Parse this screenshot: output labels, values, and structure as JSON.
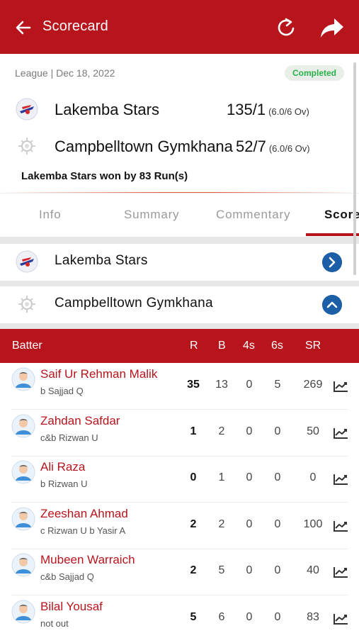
{
  "app_bar": {
    "title": "Scorecard",
    "back_icon": "arrow-left-icon",
    "refresh_icon": "refresh-icon",
    "share_icon": "share-icon"
  },
  "match": {
    "meta": "League | Dec 18, 2022",
    "status": "Completed",
    "teams": [
      {
        "name": "Lakemba Stars",
        "score": "135/1",
        "overs": "(6.0/6 Ov)"
      },
      {
        "name": "Campbelltown Gymkhana",
        "score": "52/7",
        "overs": "(6.0/6 Ov)"
      }
    ],
    "result": "Lakemba Stars won by 83 Run(s)"
  },
  "tabs": [
    {
      "label": "Info"
    },
    {
      "label": "Summary"
    },
    {
      "label": "Commentary"
    },
    {
      "label": "Score",
      "active": true
    }
  ],
  "innings": [
    {
      "team": "Lakemba Stars",
      "expanded": false
    },
    {
      "team": "Campbelltown Gymkhana",
      "expanded": true
    }
  ],
  "batting_table": {
    "headers": {
      "batter": "Batter",
      "r": "R",
      "b": "B",
      "fours": "4s",
      "sixes": "6s",
      "sr": "SR"
    },
    "rows": [
      {
        "name": "Saif Ur Rehman Malik",
        "dismissal": "b Sajjad Q",
        "r": "35",
        "b": "13",
        "fours": "0",
        "sixes": "5",
        "sr": "269"
      },
      {
        "name": "Zahdan Safdar",
        "dismissal": "c&b Rizwan U",
        "r": "1",
        "b": "2",
        "fours": "0",
        "sixes": "0",
        "sr": "50"
      },
      {
        "name": "Ali Raza",
        "dismissal": "b Rizwan U",
        "r": "0",
        "b": "1",
        "fours": "0",
        "sixes": "0",
        "sr": "0"
      },
      {
        "name": "Zeeshan Ahmad",
        "dismissal": "c Rizwan U b Yasir A",
        "r": "2",
        "b": "2",
        "fours": "0",
        "sixes": "0",
        "sr": "100"
      },
      {
        "name": "Mubeen Warraich",
        "dismissal": "c&b Sajjad Q",
        "r": "2",
        "b": "5",
        "fours": "0",
        "sixes": "0",
        "sr": "40"
      },
      {
        "name": "Bilal Yousaf",
        "dismissal": "not out",
        "r": "5",
        "b": "6",
        "fours": "0",
        "sixes": "0",
        "sr": "83"
      }
    ]
  },
  "colors": {
    "brand": "#b7141c",
    "completed_text": "#27b24a",
    "chevron_bg": "#1c5fa6"
  }
}
